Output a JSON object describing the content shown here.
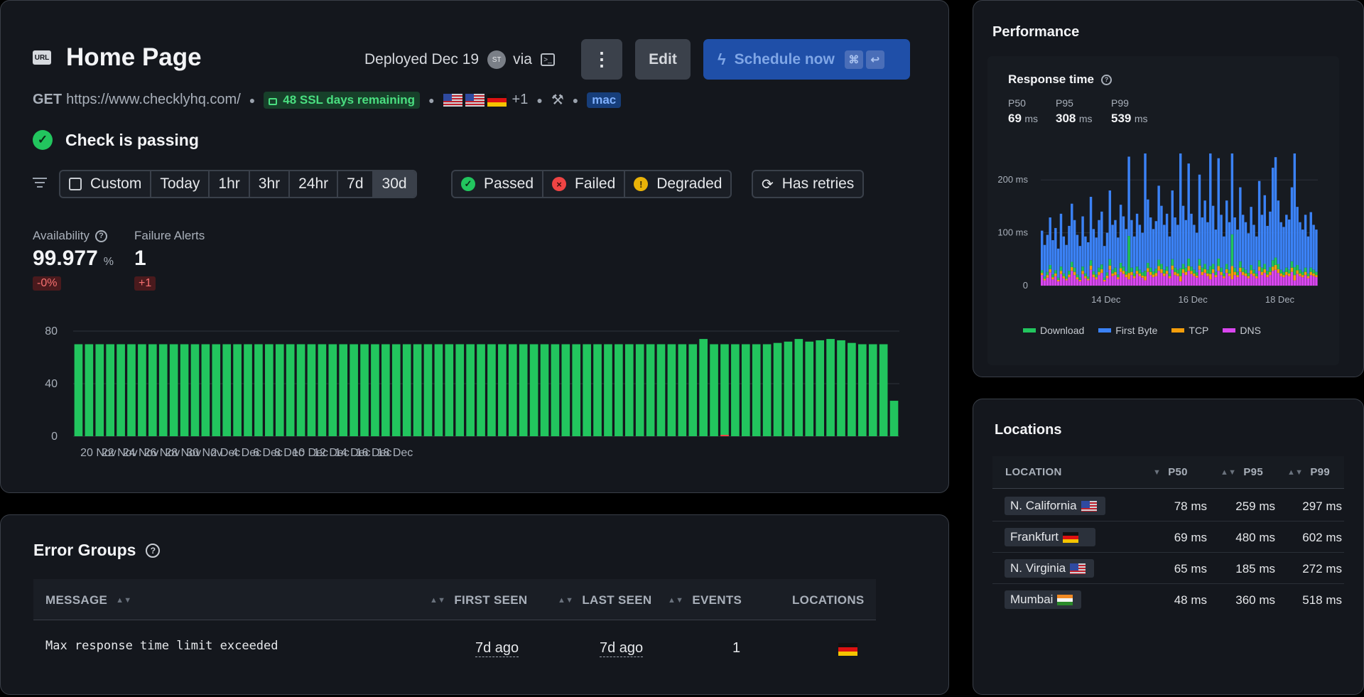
{
  "check": {
    "url_badge": "URL",
    "title": "Home Page",
    "deployed": "Deployed Dec 19",
    "avatar": "ST",
    "via": "via",
    "method": "GET",
    "url": "https://www.checklyhq.com/",
    "ssl": "48 SSL days remaining",
    "extra_locations": "+1",
    "runtime_tag": "mac",
    "status": "Check is passing",
    "more_label": "⋮",
    "edit_label": "Edit",
    "schedule_label": "Schedule now",
    "kbd1": "⌘",
    "kbd2": "↩"
  },
  "filters": {
    "ranges": [
      "Custom",
      "Today",
      "1hr",
      "3hr",
      "24hr",
      "7d",
      "30d"
    ],
    "active_range": "30d",
    "statuses": [
      "Passed",
      "Failed",
      "Degraded"
    ],
    "retries": "Has retries"
  },
  "stats": {
    "availability_label": "Availability",
    "availability_value": "99.977",
    "availability_unit": "%",
    "availability_delta": "-0%",
    "alerts_label": "Failure Alerts",
    "alerts_value": "1",
    "alerts_delta": "+1"
  },
  "chart_data": [
    {
      "type": "bar",
      "yticks": [
        "80",
        "40",
        "0"
      ],
      "ylim": [
        0,
        80
      ],
      "xticks": [
        "20 Nov",
        "22 Nov",
        "24 Nov",
        "26 Nov",
        "28 Nov",
        "30 Nov",
        "2 Dec",
        "4 Dec",
        "6 Dec",
        "8 Dec",
        "10 Dec",
        "12 Dec",
        "14 Dec",
        "16 Dec",
        "18 Dec"
      ],
      "series": [
        {
          "values": [
            70,
            70,
            70,
            70,
            70,
            70,
            70,
            70,
            70,
            70,
            70,
            70,
            70,
            70,
            70,
            70,
            70,
            70,
            70,
            70,
            70,
            70,
            70,
            70,
            70,
            70,
            70,
            70,
            70,
            70,
            70,
            70,
            70,
            70,
            70,
            70,
            70,
            70,
            70,
            70,
            70,
            70,
            70,
            70,
            70,
            70,
            70,
            70,
            70,
            70,
            70,
            70,
            70,
            70,
            70,
            70,
            70,
            70,
            70,
            74,
            70,
            70,
            70,
            70,
            70,
            70,
            71,
            72,
            74,
            72,
            73,
            74,
            73,
            71,
            70,
            70,
            70,
            27
          ],
          "failed": [
            0,
            0,
            0,
            0,
            0,
            0,
            0,
            0,
            0,
            0,
            0,
            0,
            0,
            0,
            0,
            0,
            0,
            0,
            0,
            0,
            0,
            0,
            0,
            0,
            0,
            0,
            0,
            0,
            0,
            0,
            0,
            0,
            0,
            0,
            0,
            0,
            0,
            0,
            0,
            0,
            0,
            0,
            0,
            0,
            0,
            0,
            0,
            0,
            0,
            0,
            0,
            0,
            0,
            0,
            0,
            0,
            0,
            0,
            0,
            0,
            0,
            1,
            0,
            0,
            0,
            0,
            0,
            0,
            0,
            0,
            0,
            0,
            0,
            0,
            0,
            0,
            0,
            0
          ]
        }
      ],
      "colors": {
        "passed": "#22c55e",
        "failed": "#ef4444"
      }
    },
    {
      "type": "bar",
      "title": "Response time",
      "yticks": [
        "200 ms",
        "100 ms",
        "0"
      ],
      "ylim": [
        0,
        250
      ],
      "xticks": [
        "14 Dec",
        "16 Dec",
        "18 Dec"
      ],
      "legend": [
        "Download",
        "First Byte",
        "TCP",
        "DNS"
      ],
      "colors": {
        "Download": "#22c55e",
        "First Byte": "#3b82f6",
        "TCP": "#f59e0b",
        "DNS": "#d946ef"
      },
      "first_byte": [
        75,
        60,
        70,
        90,
        65,
        80,
        55,
        100,
        70,
        60,
        85,
        110,
        90,
        75,
        60,
        95,
        70,
        65,
        120,
        80,
        70,
        90,
        100,
        60,
        75,
        130,
        85,
        90,
        70,
        110,
        95,
        80,
        150,
        90,
        70,
        100,
        85,
        75,
        245,
        120,
        95,
        80,
        90,
        140,
        110,
        85,
        100,
        70,
        130,
        95,
        85,
        230,
        110,
        90,
        180,
        100,
        85,
        75,
        160,
        95,
        120,
        90,
        215,
        110,
        80,
        190,
        100,
        70,
        120,
        90,
        230,
        95,
        80,
        140,
        100,
        90,
        75,
        110,
        85,
        70,
        150,
        100,
        130,
        85,
        105,
        175,
        190,
        120,
        90,
        85,
        100,
        95,
        140,
        250,
        110,
        90,
        80,
        100,
        70,
        105,
        85,
        80
      ],
      "download": [
        5,
        4,
        6,
        8,
        5,
        6,
        4,
        8,
        5,
        4,
        7,
        10,
        8,
        5,
        4,
        8,
        5,
        4,
        10,
        6,
        5,
        8,
        9,
        4,
        6,
        12,
        7,
        8,
        5,
        10,
        8,
        6,
        70,
        8,
        5,
        8,
        7,
        6,
        10,
        10,
        8,
        6,
        8,
        12,
        10,
        7,
        8,
        5,
        12,
        8,
        7,
        15,
        10,
        8,
        14,
        8,
        7,
        6,
        12,
        8,
        10,
        7,
        15,
        10,
        6,
        14,
        8,
        5,
        10,
        7,
        60,
        8,
        6,
        12,
        8,
        7,
        6,
        10,
        7,
        5,
        12,
        8,
        10,
        7,
        9,
        12,
        14,
        10,
        7,
        6,
        8,
        7,
        12,
        15,
        10,
        7,
        6,
        8,
        5,
        8,
        7,
        6
      ],
      "tcp": [
        4,
        3,
        5,
        6,
        4,
        5,
        3,
        6,
        4,
        3,
        5,
        7,
        6,
        4,
        3,
        6,
        4,
        3,
        8,
        5,
        4,
        6,
        7,
        3,
        5,
        8,
        5,
        6,
        4,
        7,
        6,
        5,
        12,
        6,
        4,
        6,
        5,
        4,
        8,
        7,
        6,
        5,
        6,
        9,
        7,
        5,
        6,
        4,
        8,
        6,
        5,
        10,
        7,
        6,
        9,
        6,
        5,
        4,
        8,
        6,
        7,
        5,
        10,
        7,
        4,
        9,
        6,
        4,
        7,
        5,
        25,
        6,
        4,
        8,
        6,
        5,
        4,
        7,
        5,
        4,
        8,
        6,
        7,
        5,
        6,
        8,
        9,
        7,
        5,
        4,
        6,
        5,
        8,
        10,
        7,
        5,
        4,
        6,
        4,
        6,
        5,
        4
      ],
      "dns": [
        20,
        10,
        15,
        25,
        12,
        18,
        8,
        22,
        14,
        10,
        16,
        28,
        20,
        12,
        8,
        22,
        14,
        10,
        30,
        16,
        12,
        20,
        24,
        8,
        14,
        30,
        18,
        20,
        12,
        26,
        22,
        16,
        12,
        20,
        14,
        22,
        18,
        15,
        10,
        26,
        20,
        16,
        18,
        28,
        24,
        18,
        22,
        14,
        30,
        20,
        18,
        8,
        24,
        20,
        28,
        22,
        18,
        15,
        30,
        20,
        24,
        18,
        12,
        24,
        16,
        28,
        20,
        14,
        24,
        18,
        12,
        20,
        16,
        26,
        20,
        18,
        14,
        22,
        18,
        14,
        28,
        20,
        24,
        16,
        20,
        28,
        30,
        24,
        18,
        16,
        20,
        18,
        26,
        10,
        22,
        18,
        16,
        20,
        14,
        20,
        18,
        16
      ]
    }
  ],
  "performance": {
    "title": "Performance",
    "response_title": "Response time",
    "percentiles": [
      {
        "label": "P50",
        "value": "69",
        "unit": "ms"
      },
      {
        "label": "P95",
        "value": "308",
        "unit": "ms"
      },
      {
        "label": "P99",
        "value": "539",
        "unit": "ms"
      }
    ]
  },
  "locations": {
    "title": "Locations",
    "headers": [
      "LOCATION",
      "P50",
      "P95",
      "P99"
    ],
    "rows": [
      {
        "name": "N. California",
        "flag": "us",
        "p50": "78 ms",
        "p95": "259 ms",
        "p99": "297 ms"
      },
      {
        "name": "Frankfurt",
        "flag": "de",
        "p50": "69 ms",
        "p95": "480 ms",
        "p99": "602 ms"
      },
      {
        "name": "N. Virginia",
        "flag": "us",
        "p50": "65 ms",
        "p95": "185 ms",
        "p99": "272 ms"
      },
      {
        "name": "Mumbai",
        "flag": "in",
        "p50": "48 ms",
        "p95": "360 ms",
        "p99": "518 ms"
      }
    ]
  },
  "errors": {
    "title": "Error Groups",
    "headers": [
      "MESSAGE",
      "FIRST SEEN",
      "LAST SEEN",
      "EVENTS",
      "LOCATIONS"
    ],
    "rows": [
      {
        "message": "Max response time limit exceeded",
        "first_seen": "7d ago",
        "last_seen": "7d ago",
        "events": "1",
        "flag": "de"
      }
    ]
  }
}
